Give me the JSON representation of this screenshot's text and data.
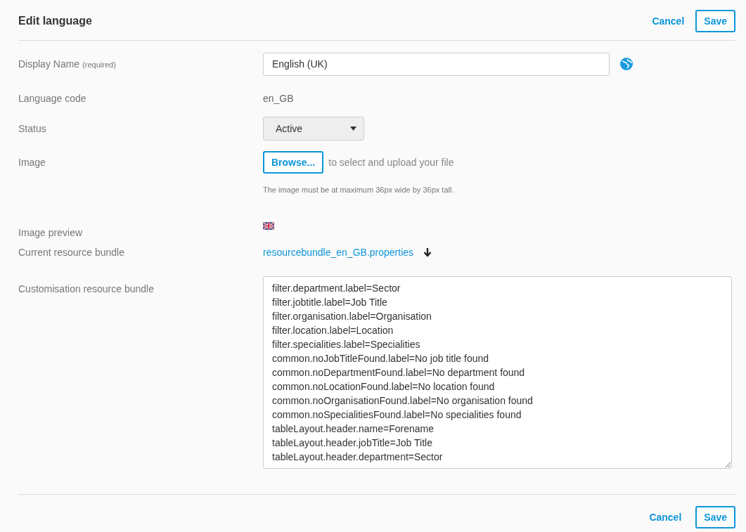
{
  "header": {
    "title": "Edit language",
    "cancel": "Cancel",
    "save": "Save"
  },
  "fields": {
    "display_name": {
      "label": "Display Name",
      "note": "(required)",
      "value": "English (UK)"
    },
    "language_code": {
      "label": "Language code",
      "value": "en_GB"
    },
    "status": {
      "label": "Status",
      "value": "Active"
    },
    "image": {
      "label": "Image",
      "button": "Browse...",
      "text": "to select and upload your file",
      "hint": "The image must be at maximum 36px wide by 36px tall."
    },
    "image_preview": {
      "label": "Image preview"
    },
    "current_bundle": {
      "label": "Current resource bundle",
      "link": "resourcebundle_en_GB.properties"
    },
    "custom_bundle": {
      "label": "Customisation resource bundle",
      "lines": [
        "filter.department.label=Sector",
        "filter.jobtitle.label=Job Title",
        "filter.organisation.label=Organisation",
        "filter.location.label=Location",
        "filter.specialities.label=Specialities",
        "common.noJobTitleFound.label=No job title found",
        "common.noDepartmentFound.label=No department found",
        "common.noLocationFound.label=No location found",
        "common.noOrganisationFound.label=No organisation found",
        "common.noSpecialitiesFound.label=No specialities found",
        "tableLayout.header.name=Forename",
        "tableLayout.header.jobTitle=Job Title",
        "tableLayout.header.department=Sector"
      ]
    }
  },
  "footer": {
    "cancel": "Cancel",
    "save": "Save"
  }
}
